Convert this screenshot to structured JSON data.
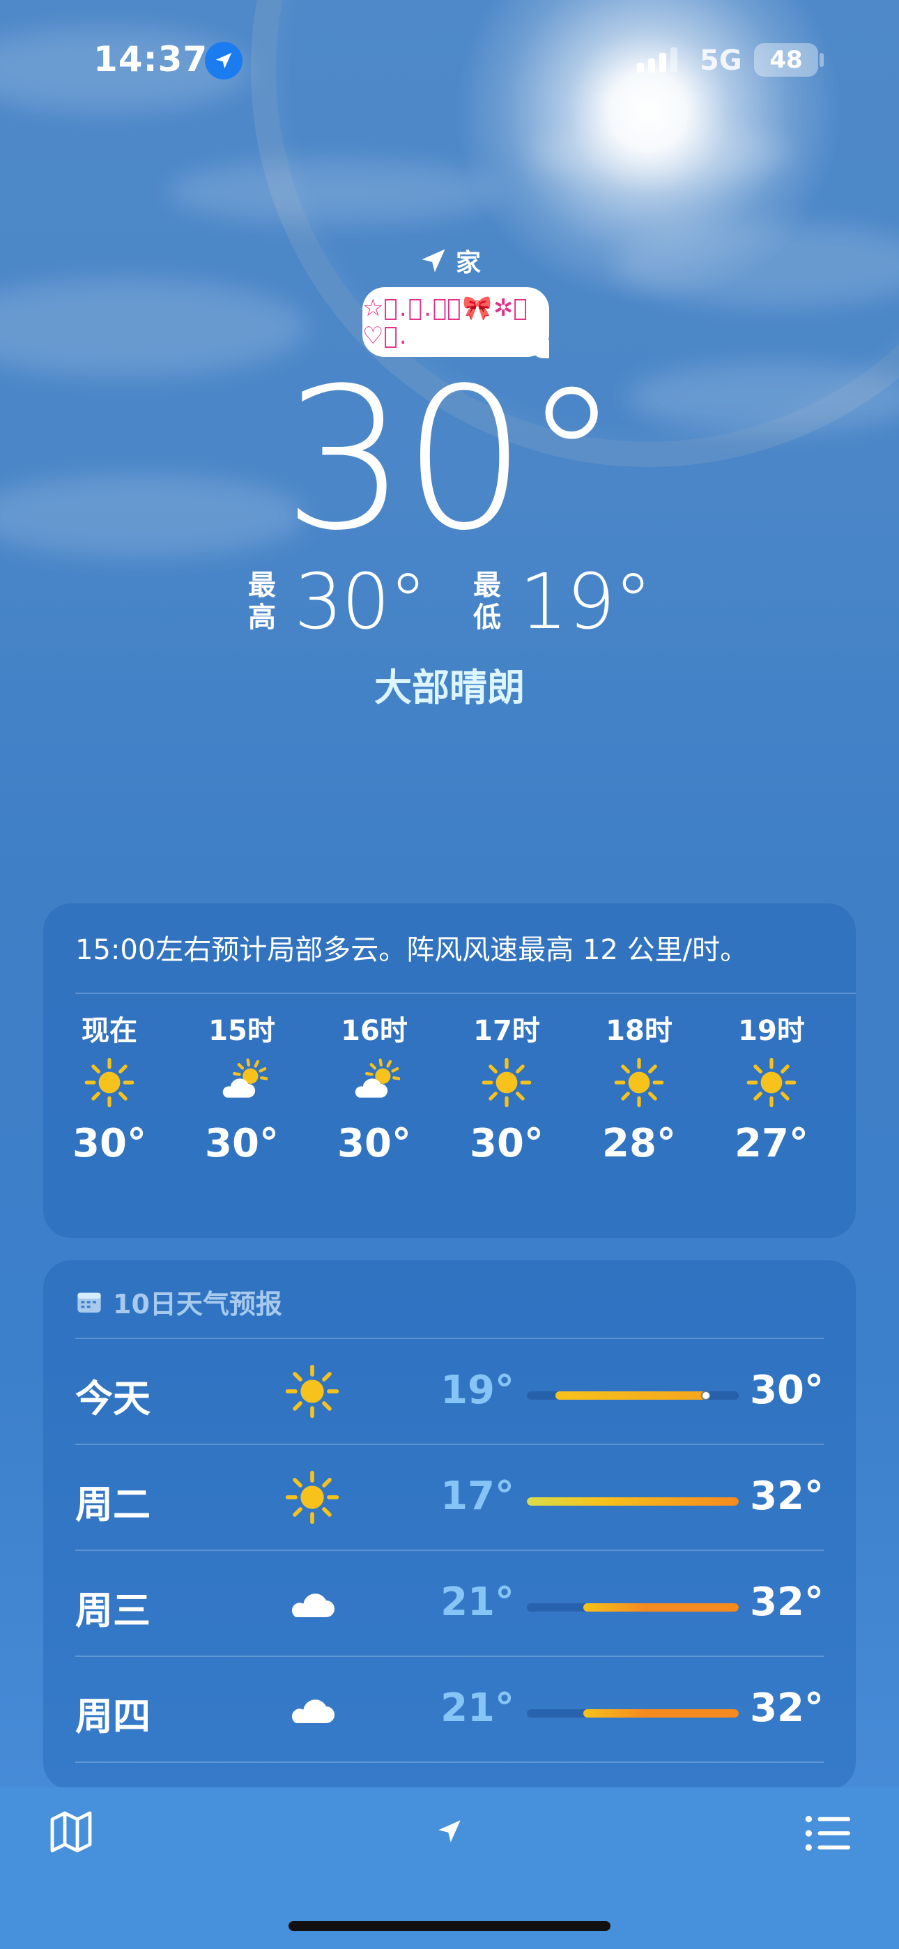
{
  "status_bar": {
    "time": "14:37",
    "network": "5G",
    "battery": "48"
  },
  "location": {
    "name": "家",
    "bubble_text": "☆ﾟ.･.｡ﾟ🎀✲ﾟ♡ﾟ."
  },
  "current": {
    "temperature": "30°",
    "high_label": "最高",
    "high": "30°",
    "low_label": "最低",
    "low": "19°",
    "condition": "大部晴朗"
  },
  "hourly": {
    "summary": "15:00左右预计局部多云。阵风风速最高 12 公里/时。",
    "items": [
      {
        "label": "现在",
        "icon": "sun-icon",
        "temp": "30°"
      },
      {
        "label": "15时",
        "icon": "partly-cloudy-icon",
        "temp": "30°"
      },
      {
        "label": "16时",
        "icon": "partly-cloudy-icon",
        "temp": "30°"
      },
      {
        "label": "17时",
        "icon": "sun-icon",
        "temp": "30°"
      },
      {
        "label": "18时",
        "icon": "sun-icon",
        "temp": "28°"
      },
      {
        "label": "19时",
        "icon": "sun-icon",
        "temp": "27°"
      }
    ]
  },
  "daily": {
    "title": "10日天气预报",
    "range": [
      17,
      32
    ],
    "days": [
      {
        "name": "今天",
        "icon": "sun-icon",
        "low": "19°",
        "high": "30°",
        "low_val": 19,
        "high_val": 30,
        "current": 30
      },
      {
        "name": "周二",
        "icon": "sun-icon",
        "low": "17°",
        "high": "32°",
        "low_val": 17,
        "high_val": 32
      },
      {
        "name": "周三",
        "icon": "cloud-icon",
        "low": "21°",
        "high": "32°",
        "low_val": 21,
        "high_val": 32
      },
      {
        "name": "周四",
        "icon": "cloud-icon",
        "low": "21°",
        "high": "32°",
        "low_val": 21,
        "high_val": 32
      }
    ]
  },
  "colors": {
    "accent_blue": "#1b7cf0",
    "bar_yellow": "#f7c21c",
    "bar_orange": "#f58a1f",
    "bar_green_yellow": "#d9dc4a"
  },
  "tabbar": {
    "left_icon": "map-icon",
    "center_icon": "location-arrow-icon",
    "right_icon": "list-icon"
  }
}
